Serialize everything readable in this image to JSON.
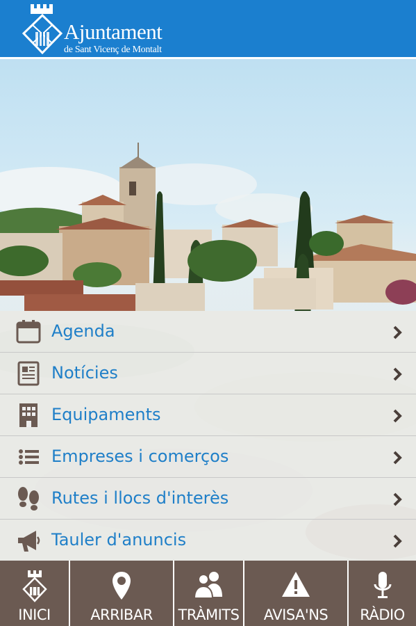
{
  "header": {
    "logo_title": "Ajuntament",
    "logo_subtitle": "de Sant Vicenç de Montalt",
    "background": "#1b7fcf"
  },
  "hero": {
    "description_icon": "town-landscape"
  },
  "menu": {
    "items": [
      {
        "label": "Agenda",
        "icon": "calendar-icon"
      },
      {
        "label": "Notícies",
        "icon": "newspaper-icon"
      },
      {
        "label": "Equipaments",
        "icon": "building-icon"
      },
      {
        "label": "Empreses i comerços",
        "icon": "list-icon"
      },
      {
        "label": "Rutes i llocs d'interès",
        "icon": "footprints-icon"
      },
      {
        "label": "Tauler d'anuncis",
        "icon": "megaphone-icon"
      }
    ],
    "label_color": "#1f7fc8"
  },
  "tabbar": {
    "background": "#6b5a52",
    "tabs": [
      {
        "label": "INICI",
        "icon": "town-crest-icon"
      },
      {
        "label": "ARRIBAR",
        "icon": "location-pin-icon"
      },
      {
        "label": "TRÀMITS",
        "icon": "people-icon"
      },
      {
        "label": "AVISA'NS",
        "icon": "warning-icon"
      },
      {
        "label": "RÀDIO",
        "icon": "microphone-icon"
      }
    ]
  }
}
